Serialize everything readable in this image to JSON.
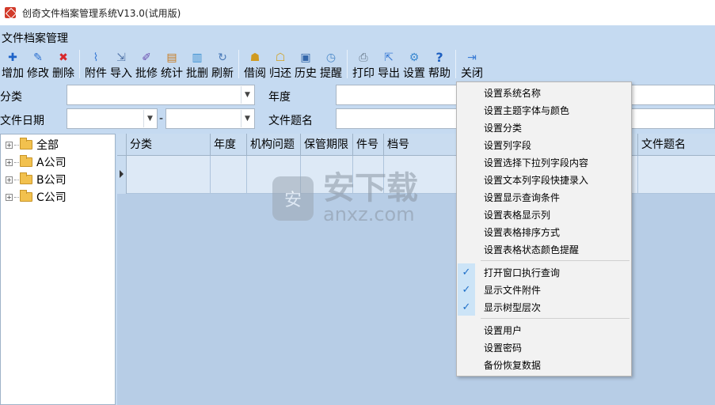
{
  "window": {
    "title": "创奇文件档案管理系统V13.0(试用版)"
  },
  "panel": {
    "title": "文件档案管理"
  },
  "toolbar": {
    "buttons": [
      {
        "label": "增加",
        "icon": "plus-icon",
        "color": "#1e63c8"
      },
      {
        "label": "修改",
        "icon": "pencil-icon",
        "color": "#2a6fd0"
      },
      {
        "label": "删除",
        "icon": "delete-x-icon",
        "color": "#d8262a"
      },
      {
        "label": "附件",
        "icon": "paperclip-icon",
        "color": "#3a7bd5"
      },
      {
        "label": "导入",
        "icon": "import-icon",
        "color": "#5577aa"
      },
      {
        "label": "批修",
        "icon": "batch-edit-icon",
        "color": "#6a4fb0"
      },
      {
        "label": "统计",
        "icon": "clipboard-icon",
        "color": "#c77a1e"
      },
      {
        "label": "批删",
        "icon": "batch-delete-icon",
        "color": "#3a8fd0"
      },
      {
        "label": "刷新",
        "icon": "refresh-icon",
        "color": "#4a7ab8"
      },
      {
        "label": "借阅",
        "icon": "borrow-icon",
        "color": "#d09a20"
      },
      {
        "label": "归还",
        "icon": "return-icon",
        "color": "#d0a020"
      },
      {
        "label": "历史",
        "icon": "history-icon",
        "color": "#3366aa"
      },
      {
        "label": "提醒",
        "icon": "clock-icon",
        "color": "#4a88c8"
      },
      {
        "label": "打印",
        "icon": "printer-icon",
        "color": "#667788"
      },
      {
        "label": "导出",
        "icon": "export-icon",
        "color": "#3a7bd5"
      },
      {
        "label": "设置",
        "icon": "gear-icon",
        "color": "#3a88d0"
      },
      {
        "label": "帮助",
        "icon": "help-icon",
        "color": "#1e5fc0"
      },
      {
        "label": "关闭",
        "icon": "exit-door-icon",
        "color": "#3a7bd5"
      }
    ]
  },
  "filters": {
    "category_label": "分类",
    "year_label": "年度",
    "date_label": "文件日期",
    "date_separator": "-",
    "title_label": "文件题名"
  },
  "tree": {
    "items": [
      "全部",
      "A公司",
      "B公司",
      "C公司"
    ]
  },
  "grid": {
    "columns": [
      "分类",
      "年度",
      "机构问题",
      "保管期限",
      "件号",
      "档号"
    ],
    "right_column": "文件题名"
  },
  "watermark": {
    "text": "安下载",
    "sub": "anxz.com",
    "glyph": "安"
  },
  "menu": {
    "group1": [
      "设置系统名称",
      "设置主题字体与颜色",
      "设置分类",
      "设置列字段",
      "设置选择下拉列字段内容",
      "设置文本列字段快捷录入",
      "设置显示查询条件",
      "设置表格显示列",
      "设置表格排序方式",
      "设置表格状态颜色提醒"
    ],
    "group2": [
      "打开窗口执行查询",
      "显示文件附件",
      "显示树型层次"
    ],
    "group3": [
      "设置用户",
      "设置密码",
      "备份恢复数据"
    ],
    "check_glyph": "✓"
  }
}
